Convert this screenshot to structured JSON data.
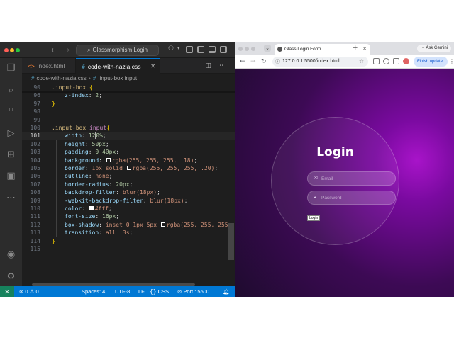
{
  "editor_window": {
    "nav_back": "←",
    "nav_forward": "→",
    "command_center": "Glassmorphism Login",
    "tabs": [
      {
        "label": "index.html",
        "icon": "<>",
        "active": false
      },
      {
        "label": "code-with-nazia.css",
        "icon": "#",
        "active": true
      }
    ],
    "breadcrumb": {
      "file": "code-with-nazia.css",
      "symbol": ".input-box input"
    },
    "activity_icons": [
      "explorer-icon",
      "search-icon",
      "source-control-icon",
      "run-debug-icon",
      "extensions-icon",
      "remote-explorer-icon",
      "more-icon",
      "account-icon",
      "settings-gear-icon"
    ],
    "gutter": [
      "90",
      "96",
      "97",
      "98",
      "99",
      "100",
      "101",
      "102",
      "103",
      "104",
      "105",
      "106",
      "107",
      "108",
      "109",
      "110",
      "111",
      "112",
      "113",
      "114",
      "115"
    ],
    "code": {
      "l90_sel": ".input-box",
      "l90_brace": "{",
      "l96_prop": "z-index",
      "l96_val": "2",
      "l97_brace": "}",
      "l100_sel": ".input-box",
      "l100_tag": "input",
      "l100_brace": "{",
      "l101_prop": "width",
      "l101_val_a": "12",
      "l101_val_b": "0%",
      "l102_prop": "height",
      "l102_val": "50px",
      "l103_prop": "padding",
      "l103_val": "0 40px",
      "l104_prop": "background",
      "l104_val": "rgba(255, 255, 255, .18)",
      "l105_prop": "border",
      "l105_val_a": "1px solid",
      "l105_val_b": "rgba(255, 255, 255, .20)",
      "l106_prop": "outline",
      "l106_val": "none",
      "l107_prop": "border-radius",
      "l107_val": "20px",
      "l108_prop": "backdrop-filter",
      "l108_val": "blur(18px)",
      "l109_prop": "-webkit-backdrop-filter",
      "l109_val": "blur(18px)",
      "l110_prop": "color",
      "l110_val": "#fff",
      "l111_prop": "font-size",
      "l111_val": "16px",
      "l112_prop": "box-shadow",
      "l112_val_a": "inset 0 1px 5px",
      "l112_val_b": "rgba(255, 255, 255, .0",
      "l113_prop": "transition",
      "l113_val": "all .3s",
      "l114_brace": "}"
    },
    "status_bar": {
      "errors": "0",
      "warnings": "0",
      "spaces": "Spaces: 4",
      "encoding": "UTF-8",
      "eol": "LF",
      "language": "CSS",
      "port": "Port : 5500"
    }
  },
  "browser": {
    "tab_title": "Glass Login Form",
    "new_tab": "+",
    "ask_gemini": "Ask Gemini",
    "url": "127.0.0.1:5500/index.html",
    "finish_update": "Finish update",
    "page": {
      "heading": "Login",
      "email_placeholder": "Email",
      "password_placeholder": "Password",
      "button_label": "Login"
    }
  },
  "colors": {
    "statusbar": "#0078d4",
    "page_glow": "#a814c9",
    "editor_bg": "#1e1e1e"
  }
}
